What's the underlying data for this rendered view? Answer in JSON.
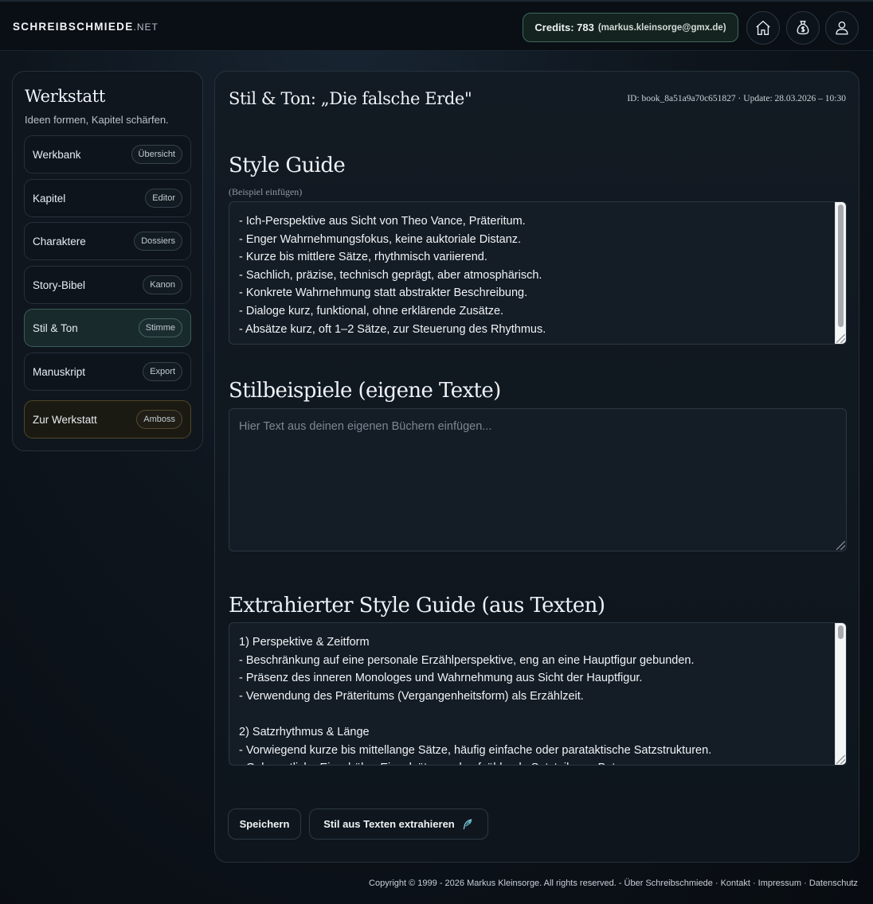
{
  "header": {
    "brand_main": "SCHREIBSCHMIEDE",
    "brand_suffix": ".NET",
    "credits_label": "Credits: 783",
    "credits_email": "(markus.kleinsorge@gmx.de)",
    "icons": [
      "home-icon",
      "money-bag-icon",
      "user-icon"
    ]
  },
  "sidebar": {
    "title": "Werkstatt",
    "subtitle": "Ideen formen, Kapitel schärfen.",
    "items": [
      {
        "label": "Werkbank",
        "badge": "Übersicht"
      },
      {
        "label": "Kapitel",
        "badge": "Editor"
      },
      {
        "label": "Charaktere",
        "badge": "Dossiers"
      },
      {
        "label": "Story-Bibel",
        "badge": "Kanon"
      },
      {
        "label": "Stil & Ton",
        "badge": "Stimme"
      },
      {
        "label": "Manuskript",
        "badge": "Export"
      },
      {
        "label": "Zur Werkstatt",
        "badge": "Amboss"
      }
    ]
  },
  "main": {
    "title": "Stil & Ton: „Die falsche Erde\"",
    "meta": "ID: book_8a51a9a70c651827 · Update: 28.03.2026 – 10:30",
    "style_guide": {
      "heading": "Style Guide",
      "hint": "(Beispiel einfügen)",
      "value": "- Ich-Perspektive aus Sicht von Theo Vance, Präteritum.\n- Enger Wahrnehmungsfokus, keine auktoriale Distanz.\n- Kurze bis mittlere Sätze, rhythmisch variierend.\n- Sachlich, präzise, technisch geprägt, aber atmosphärisch.\n- Konkrete Wahrnehmung statt abstrakter Beschreibung.\n- Dialoge kurz, funktional, ohne erklärende Zusätze.\n- Absätze kurz, oft 1–2 Sätze, zur Steuerung des Rhythmus."
    },
    "examples": {
      "heading": "Stilbeispiele (eigene Texte)",
      "placeholder": "Hier Text aus deinen eigenen Büchern einfügen..."
    },
    "extracted": {
      "heading": "Extrahierter Style Guide (aus Texten)",
      "value": "1) Perspektive & Zeitform\n- Beschränkung auf eine personale Erzählperspektive, eng an eine Hauptfigur gebunden.\n- Präsenz des inneren Monologes und Wahrnehmung aus Sicht der Hauptfigur.\n- Verwendung des Präteritums (Vergangenheitsform) als Erzählzeit.\n\n2) Satzrhythmus & Länge\n- Vorwiegend kurze bis mittellange Sätze, häufig einfache oder parataktische Satzstrukturen.\n- Gelegentliche Einschübe, Einzelsätze und aufzählende Satzteile zur Betonung."
    },
    "buttons": {
      "save": "Speichern",
      "extract": "Stil aus Texten extrahieren"
    }
  },
  "footer": {
    "text": "Copyright © 1999 - 2026 Markus Kleinsorge. All rights reserved. - Über Schreibschmiede · Kontakt · Impressum · Datenschutz"
  }
}
